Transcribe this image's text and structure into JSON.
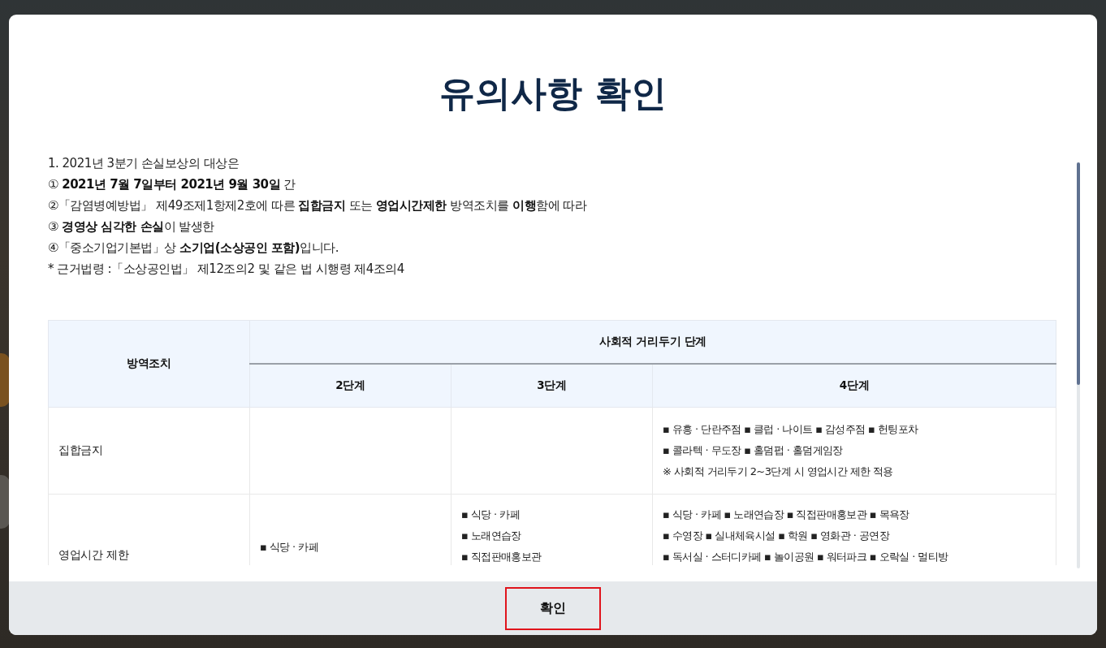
{
  "dialog": {
    "title": "유의사항 확인",
    "intro": [
      "1. 2021년 3분기 손실보상의 대상은",
      "① **2021년 7월 7일부터 2021년 9월 30일** 간",
      "②「감염병예방법」 제49조제1항제2호에 따른 **집합금지** 또는 **영업시간제한** 방역조치를 **이행**함에 따라",
      "③ **경영상 심각한 손실**이 발생한",
      "④「중소기업기본법」상 **소기업(소상공인 포함)**입니다.",
      "* 근거법령 :「소상공인법」 제12조의2 및 같은 법 시행령 제4조의4"
    ],
    "table": {
      "corner": "방역조치",
      "group": "사회적 거리두기 단계",
      "columns": [
        "2단계",
        "3단계",
        "4단계"
      ],
      "rows": [
        {
          "label": "집합금지",
          "cells": [
            [],
            [],
            [
              "▪ 유흥 · 단란주점 ▪ 클럽 · 나이트 ▪ 감성주점 ▪ 헌팅포차",
              "▪ 콜라텍 · 무도장 ▪ 홀덤펍 · 홀덤게임장",
              "※ 사회적 거리두기 2~3단계 시 영업시간 제한 적용"
            ]
          ]
        },
        {
          "label": "영업시간 제한",
          "cells": [
            [
              "▪ 식당 · 카페"
            ],
            [
              "▪ 식당 · 카페",
              "▪ 노래연습장",
              "▪ 직접판매홍보관"
            ],
            [
              "▪ 식당 · 카페 ▪ 노래연습장 ▪ 직접판매홍보관 ▪ 목욕장",
              "▪ 수영장 ▪ 실내체육시설 ▪ 학원 ▪ 영화관 · 공연장",
              "▪ 독서실 · 스터디카페 ▪ 놀이공원 ▪ 워터파크 ▪ 오락실 · 멀티방"
            ]
          ]
        }
      ]
    },
    "confirm_button": "확인"
  }
}
